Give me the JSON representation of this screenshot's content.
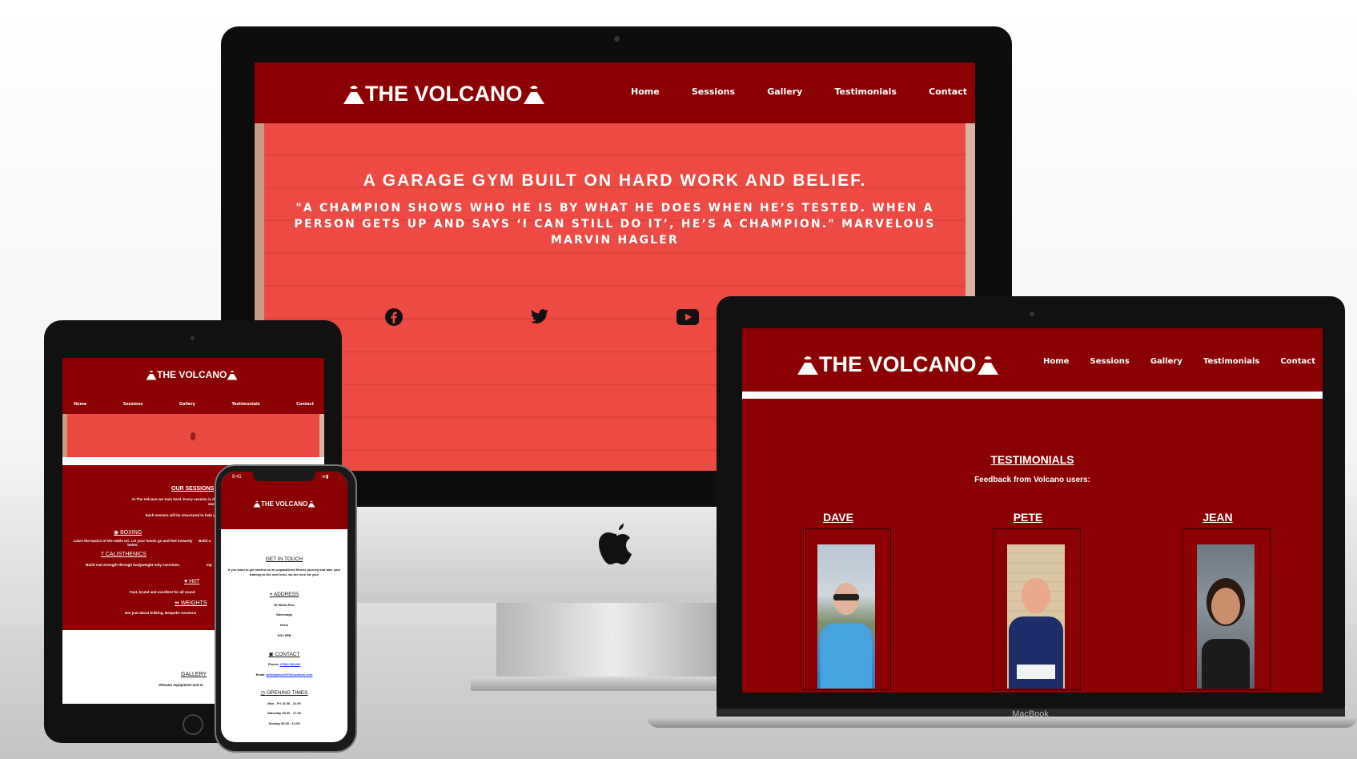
{
  "site": {
    "logo_text": "THE VOLCANO",
    "nav": [
      "Home",
      "Sessions",
      "Gallery",
      "Testimonials",
      "Contact"
    ]
  },
  "imac": {
    "hero_title": "A GARAGE GYM BUILT ON HARD WORK AND BELIEF.",
    "hero_quote": "\"A CHAMPION SHOWS WHO HE IS BY WHAT HE DOES WHEN HE’S TESTED. WHEN A PERSON GETS UP AND SAYS ‘I CAN STILL DO IT’, HE’S A CHAMPION.\" MARVELOUS MARVIN HAGLER",
    "social_icons": [
      "facebook-icon",
      "twitter-icon",
      "youtube-icon"
    ]
  },
  "laptop": {
    "section_title": "TESTIMONIALS",
    "section_subtitle": "Feedback from Volcano users:",
    "people": [
      "DAVE",
      "PETE",
      "JEAN"
    ],
    "brand": "MacBook"
  },
  "ipad": {
    "sessions_title": "OUR SESSIONS",
    "sessions_intro": "At The Volcano we train hard. Every session is designed to push you",
    "sessions_intro2": "worth it.",
    "sessions_note": "Each session will be structured to help you conquer your",
    "boxing": "BOXING",
    "boxing_text": "Learn the basics of the noble art. Let your hands go and feel instantly better.",
    "calisthenics": "CALISTHENICS",
    "calisthenics_text": "Build real strength through bodyweight only exercises.",
    "hiit": "HIIT",
    "hiit_text": "Fast, brutal and excellent for all round",
    "weights": "WEIGHTS",
    "weights_text": "Not just about bulking. Bespoke sessions",
    "gallery_title": "GALLERY",
    "gallery_text": "Volcano equipment and m"
  },
  "phone": {
    "time": "9:41",
    "get_in_touch": "GET IN TOUCH",
    "intro": "If you want to get started on an unparalleled fitness journey and take your training to the next level, we are here for you!",
    "address_title": "ADDRESS",
    "address_lines": [
      "35 Webb Rise",
      "Stevenage",
      "Herts",
      "SG1 5PB"
    ],
    "contact_title": "CONTACT",
    "phone_label": "Phone:",
    "phone_value": "07584 552233",
    "email_label": "Email:",
    "email_value": "peterjames1975@outlook.com",
    "opening_title": "OPENING TIMES",
    "hours": [
      "Mon - Fri 16.00 - 21.00",
      "Saturday 05.00 - 17.00",
      "Sunday 05.00 - 12.00"
    ]
  },
  "colors": {
    "brand_red": "#8b0000",
    "hero_red": "#e8453c",
    "link_blue": "#1a3cff"
  }
}
